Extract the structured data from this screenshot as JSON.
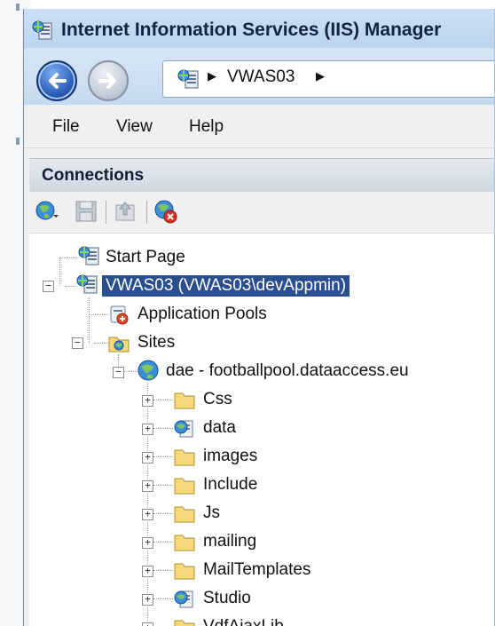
{
  "window": {
    "title": "Internet Information Services (IIS) Manager",
    "accent": "#2a4f91"
  },
  "navigation": {
    "back_icon": "back-arrow-icon",
    "forward_icon": "forward-arrow-icon",
    "address": {
      "icon": "server-icon",
      "server": "VWAS03"
    }
  },
  "menu": {
    "items": [
      {
        "label": "File"
      },
      {
        "label": "View"
      },
      {
        "label": "Help"
      }
    ]
  },
  "connections": {
    "title": "Connections",
    "toolbar": [
      "connect-globe-icon",
      "save-icon",
      "upload-icon",
      "disconnect-icon"
    ]
  },
  "tree": {
    "start_page": "Start Page",
    "server": "VWAS03 (VWAS03\\devAppmin)",
    "app_pools": "Application Pools",
    "sites": "Sites",
    "site": "dae - footballpool.dataaccess.eu",
    "children": [
      {
        "label": "Css",
        "type": "folder"
      },
      {
        "label": "data",
        "type": "application"
      },
      {
        "label": "images",
        "type": "folder"
      },
      {
        "label": "Include",
        "type": "folder"
      },
      {
        "label": "Js",
        "type": "folder"
      },
      {
        "label": "mailing",
        "type": "folder"
      },
      {
        "label": "MailTemplates",
        "type": "folder"
      },
      {
        "label": "Studio",
        "type": "application"
      },
      {
        "label": "VdfAjaxLib",
        "type": "folder"
      }
    ]
  }
}
